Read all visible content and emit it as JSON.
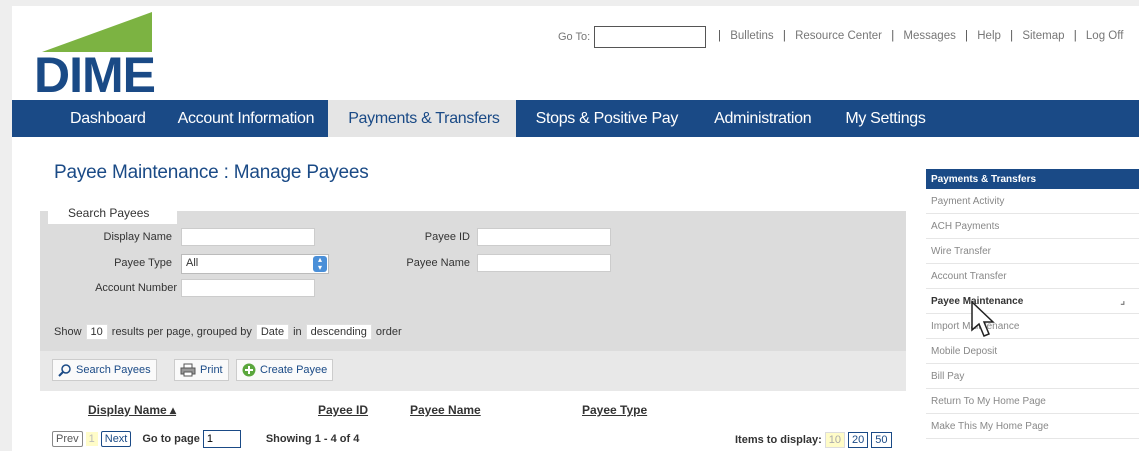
{
  "logo": {
    "text": "DIME",
    "green": "#7cb342",
    "blue": "#1a4a86"
  },
  "header": {
    "goto_label": "Go To:",
    "goto_value": "",
    "links": [
      "Bulletins",
      "Resource Center",
      "Messages",
      "Help",
      "Sitemap",
      "Log Off"
    ]
  },
  "nav": {
    "tabs": [
      {
        "label": "Dashboard"
      },
      {
        "label": "Account Information"
      },
      {
        "label": "Payments & Transfers",
        "active": true
      },
      {
        "label": "Stops & Positive Pay"
      },
      {
        "label": "Administration"
      },
      {
        "label": "My Settings"
      }
    ]
  },
  "page": {
    "title": "Payee Maintenance : Manage Payees"
  },
  "search": {
    "legend": "Search Payees",
    "display_name_label": "Display Name",
    "payee_id_label": "Payee ID",
    "payee_type_label": "Payee Type",
    "payee_type_value": "All",
    "payee_name_label": "Payee Name",
    "account_number_label": "Account Number",
    "show": "Show",
    "per_page": "10",
    "results_text": "results per page, grouped by",
    "group_by": "Date",
    "in": "in",
    "order": "descending",
    "order_word": "order"
  },
  "buttons": {
    "search": "Search Payees",
    "print": "Print",
    "create": "Create Payee"
  },
  "table": {
    "columns": [
      "Display Name ▴",
      "Payee ID",
      "Payee Name",
      "Payee Type"
    ]
  },
  "pager": {
    "prev": "Prev",
    "current": "1",
    "next": "Next",
    "goto_label": "Go to page",
    "goto_value": "1",
    "showing": "Showing 1 - 4 of 4",
    "items_label": "Items to display:",
    "options": [
      "10",
      "20",
      "50"
    ]
  },
  "sidebar": {
    "title": "Payments & Transfers",
    "items": [
      {
        "label": "Payment Activity"
      },
      {
        "label": "ACH Payments"
      },
      {
        "label": "Wire Transfer"
      },
      {
        "label": "Account Transfer"
      },
      {
        "label": "Payee Maintenance",
        "active": true
      },
      {
        "label": "Import Maintenance"
      },
      {
        "label": "Mobile Deposit"
      },
      {
        "label": "Bill Pay"
      },
      {
        "label": "Return To My Home Page"
      },
      {
        "label": "Make This My Home Page"
      }
    ]
  }
}
